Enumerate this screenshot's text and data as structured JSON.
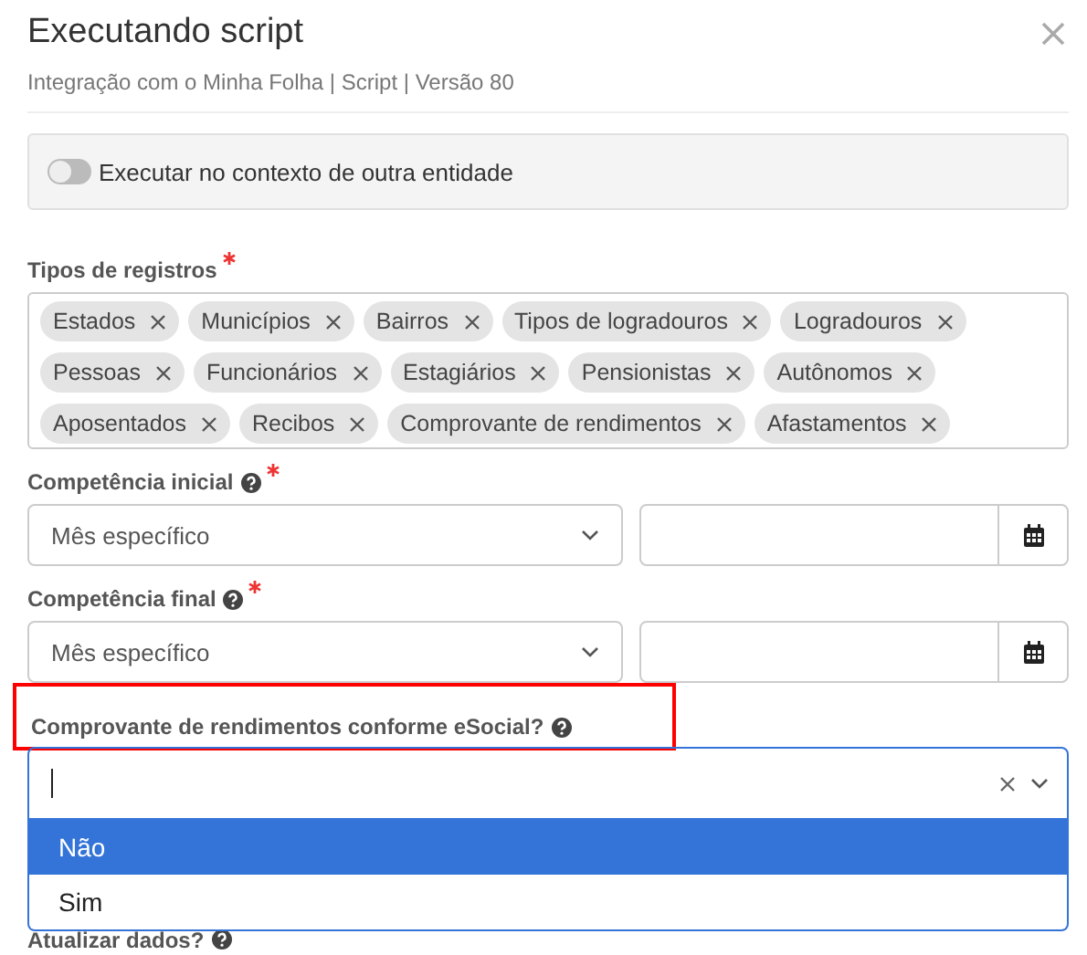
{
  "dialog": {
    "title": "Executando script",
    "subtitle": "Integração com o Minha Folha | Script | Versão 80"
  },
  "context_toggle": {
    "label": "Executar no contexto de outra entidade",
    "on": false
  },
  "record_types": {
    "label": "Tipos de registros",
    "required": true,
    "tags": [
      {
        "label": "Estados"
      },
      {
        "label": "Municípios"
      },
      {
        "label": "Bairros"
      },
      {
        "label": "Tipos de logradouros"
      },
      {
        "label": "Logradouros"
      },
      {
        "label": "Pessoas"
      },
      {
        "label": "Funcionários"
      },
      {
        "label": "Estagiários"
      },
      {
        "label": "Pensionistas"
      },
      {
        "label": "Autônomos"
      },
      {
        "label": "Aposentados"
      },
      {
        "label": "Recibos"
      },
      {
        "label": "Comprovante de rendimentos"
      },
      {
        "label": "Afastamentos"
      }
    ]
  },
  "periods": [
    {
      "label": "Competência inicial",
      "help": true,
      "required": true,
      "select_value": "Mês específico"
    },
    {
      "label": "Competência final",
      "help": true,
      "required": true,
      "select_value": "Mês específico"
    }
  ],
  "esocial_question": {
    "label": "Comprovante de rendimentos conforme eSocial?",
    "help": true,
    "highlighted": true,
    "expanded": true,
    "options": [
      {
        "label": "Não",
        "selected": true
      },
      {
        "label": "Sim",
        "selected": false
      }
    ]
  },
  "next_field": {
    "label": "Atualizar dados?",
    "help": true
  }
}
